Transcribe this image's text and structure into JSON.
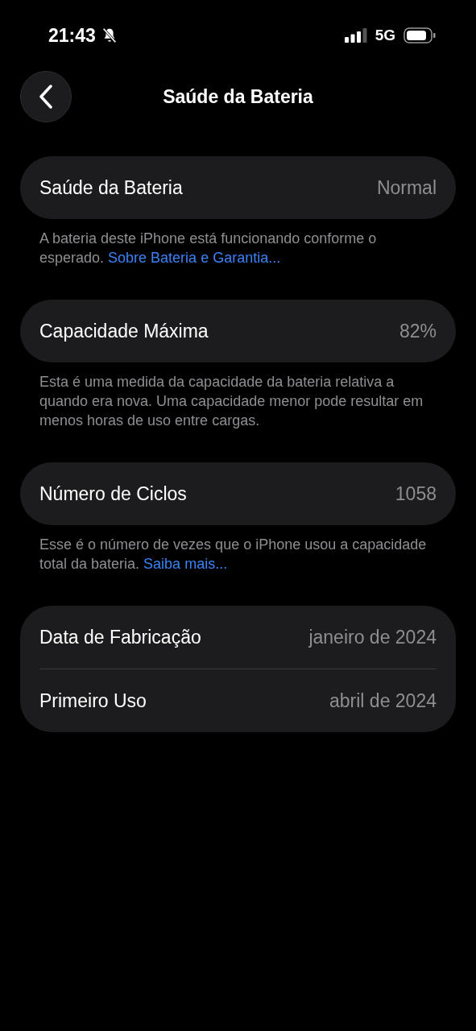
{
  "status_bar": {
    "time": "21:43",
    "network": "5G",
    "silent": true
  },
  "nav": {
    "title": "Saúde da Bateria"
  },
  "groups": [
    {
      "rows": [
        {
          "label": "Saúde da Bateria",
          "value": "Normal"
        }
      ],
      "footer": {
        "text": "A bateria deste iPhone está funcionando conforme o esperado. ",
        "link": "Sobre Bateria e Garantia..."
      }
    },
    {
      "rows": [
        {
          "label": "Capacidade Máxima",
          "value": "82%"
        }
      ],
      "footer": {
        "text": "Esta é uma medida da capacidade da bateria relativa a quando era nova. Uma capacidade menor pode resultar em menos horas de uso entre cargas."
      }
    },
    {
      "rows": [
        {
          "label": "Número de Ciclos",
          "value": "1058"
        }
      ],
      "footer": {
        "text": "Esse é o número de vezes que o iPhone usou a capacidade total da bateria. ",
        "link": "Saiba mais..."
      }
    },
    {
      "rows": [
        {
          "label": "Data de Fabricação",
          "value": "janeiro de 2024"
        },
        {
          "label": "Primeiro Uso",
          "value": "abril de 2024"
        }
      ]
    }
  ]
}
